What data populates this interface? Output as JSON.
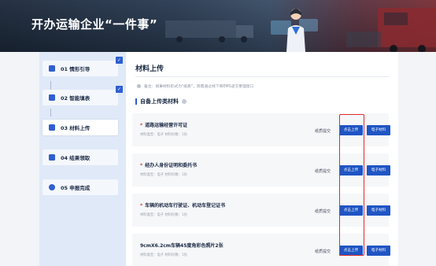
{
  "banner": {
    "title": "开办运输企业“一件事”"
  },
  "sidebar": {
    "steps": [
      {
        "label": "01 情形引导",
        "done": true
      },
      {
        "label": "02 智能填表",
        "done": true
      },
      {
        "label": "03 材料上传",
        "done": false,
        "active": true
      },
      {
        "label": "04 结果领取",
        "done": false
      },
      {
        "label": "05 申报完成",
        "done": false
      }
    ]
  },
  "main": {
    "title": "材料上传",
    "note": "备注：如果材料形式为\"纸质\"，则需通过线下寄EMS递交受理窗口",
    "section": "自备上传类材料",
    "items": [
      {
        "title": "道路运输经营许可证",
        "required": true,
        "meta": "材料类型：电子   材料份数：1份",
        "paper": "纸质提交",
        "upload": "点击上传",
        "ecopy": "电子材料"
      },
      {
        "title": "经办人身份证明和委托书",
        "required": true,
        "meta": "材料类型：电子   材料份数：1份",
        "paper": "纸质提交",
        "upload": "点击上传",
        "ecopy": "电子材料"
      },
      {
        "title": "车辆的机动车行驶证、机动车登记证书",
        "required": true,
        "meta": "材料类型：电子   材料份数：1份",
        "paper": "纸质提交",
        "upload": "点击上传",
        "ecopy": "电子材料"
      },
      {
        "title": "9cmX6.2cm车辆45度角彩色照片2张",
        "required": false,
        "meta": "材料类型：电子   材料份数：1份",
        "paper": "纸质提交",
        "upload": "点击上传",
        "ecopy": "电子材料"
      }
    ]
  },
  "colors": {
    "accent": "#1f55c4",
    "highlight": "#e02c2c",
    "required": "#e03a3a"
  }
}
